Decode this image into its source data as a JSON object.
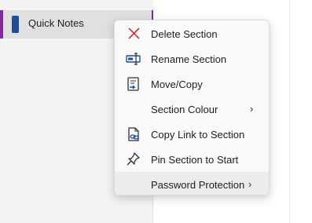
{
  "section_list": {
    "active_section": "Quick Notes",
    "accent_color": "#7d2c9e",
    "tab_color": "#1f4e97"
  },
  "context_menu": {
    "items": [
      {
        "label": "Delete Section",
        "icon": "delete-x-icon"
      },
      {
        "label": "Rename Section",
        "icon": "rename-icon"
      },
      {
        "label": "Move/Copy",
        "icon": "move-copy-icon"
      },
      {
        "label": "Section Colour",
        "icon": "",
        "submenu": true
      },
      {
        "label": "Copy Link to Section",
        "icon": "copy-link-icon"
      },
      {
        "label": "Pin Section to Start",
        "icon": "pin-icon"
      },
      {
        "label": "Password Protection",
        "icon": "",
        "submenu": true,
        "highlighted": true
      }
    ],
    "chevron": "›"
  }
}
